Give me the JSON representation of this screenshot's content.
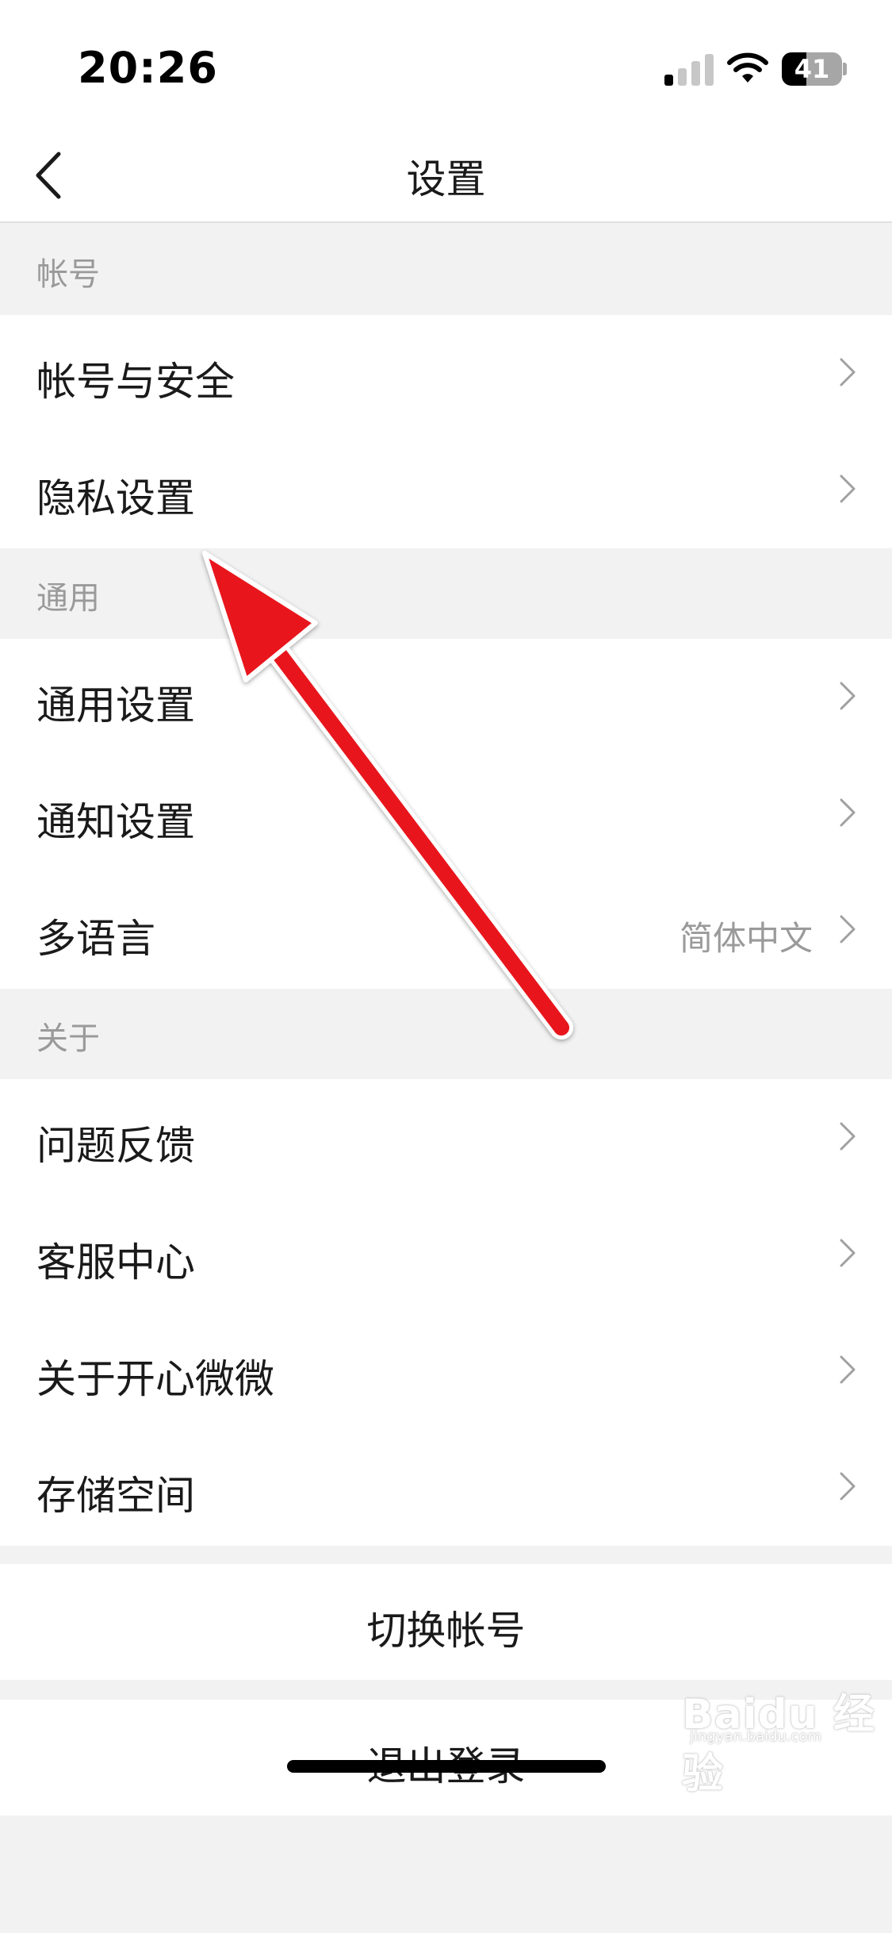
{
  "status_bar": {
    "time": "20:26",
    "battery_level": "41",
    "battery_fraction": 0.41,
    "signal_bars_active": 1,
    "signal_bars_total": 4
  },
  "nav": {
    "title": "设置",
    "back_icon": "chevron-left-icon"
  },
  "sections": [
    {
      "header": "帐号",
      "items": [
        {
          "label": "帐号与安全",
          "value": ""
        },
        {
          "label": "隐私设置",
          "value": ""
        }
      ]
    },
    {
      "header": "通用",
      "items": [
        {
          "label": "通用设置",
          "value": ""
        },
        {
          "label": "通知设置",
          "value": ""
        },
        {
          "label": "多语言",
          "value": "简体中文"
        }
      ]
    },
    {
      "header": "关于",
      "items": [
        {
          "label": "问题反馈",
          "value": ""
        },
        {
          "label": "客服中心",
          "value": ""
        },
        {
          "label": "关于开心微微",
          "value": ""
        },
        {
          "label": "存储空间",
          "value": ""
        }
      ]
    }
  ],
  "actions": {
    "switch_account": "切换帐号",
    "logout": "退出登录"
  },
  "watermark": {
    "brand": "Baidu 经验",
    "url": "jingyan.baidu.com"
  },
  "colors": {
    "background": "#f2f2f2",
    "surface": "#ffffff",
    "text_primary": "#1a1a1a",
    "text_secondary": "#9a9a9a",
    "annotation_arrow": "#e8141b"
  },
  "icons": {
    "row_chevron": "chevron-right-icon",
    "annotation": "red-arrow-icon"
  }
}
